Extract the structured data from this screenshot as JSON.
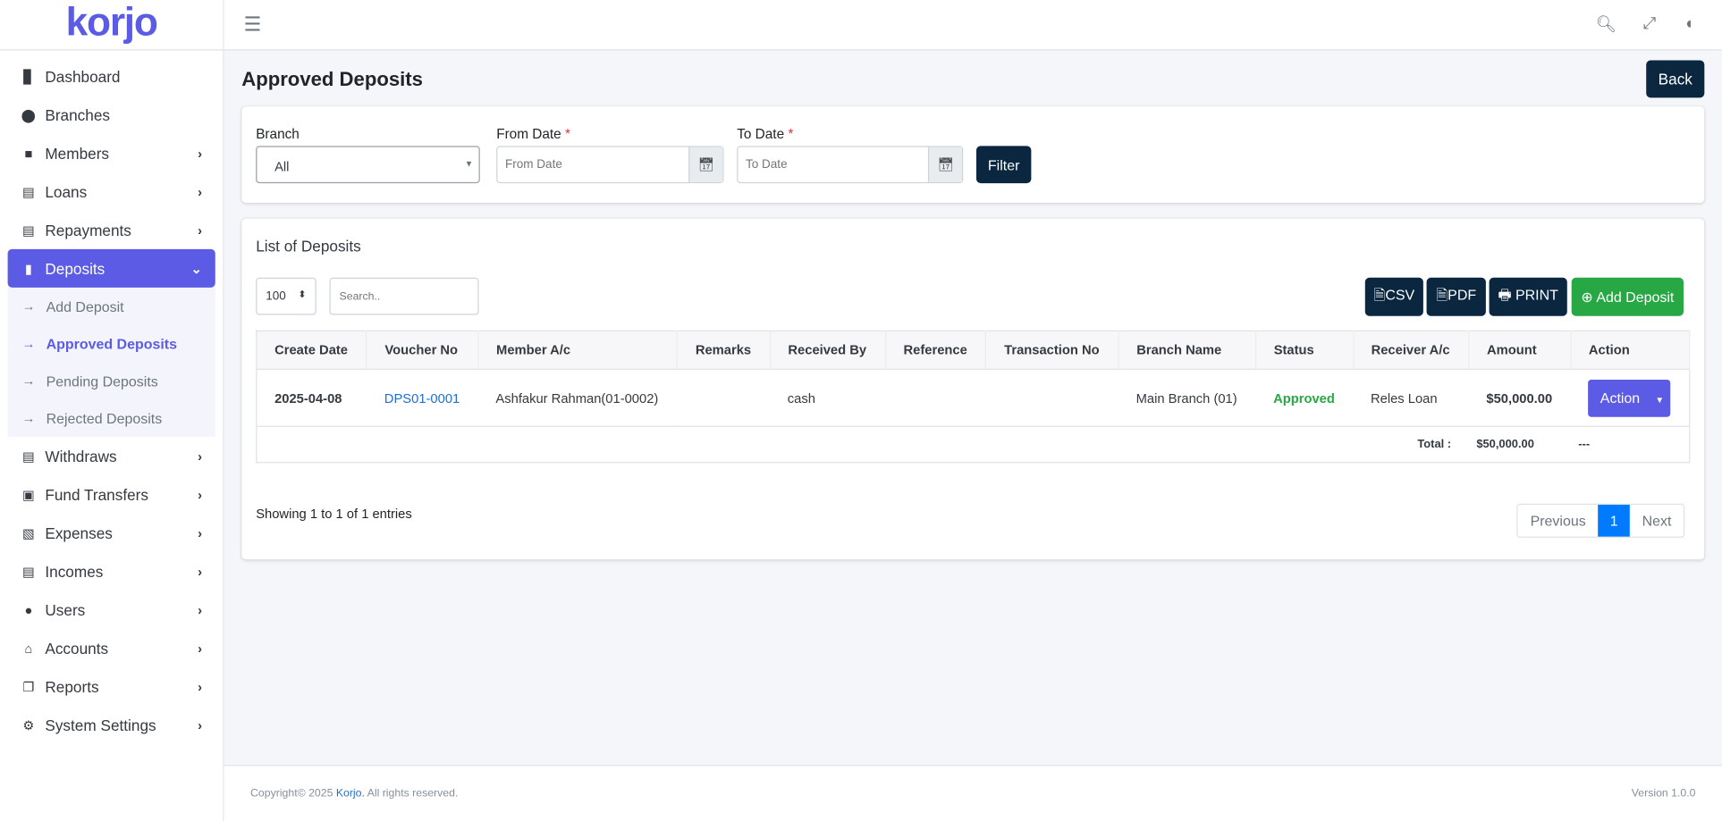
{
  "brand": {
    "logo": "korjo",
    "accent": "#5b5be6"
  },
  "sidebar": {
    "items": [
      {
        "label": "Dashboard",
        "icon": "chart-bar-icon",
        "chev": false
      },
      {
        "label": "Branches",
        "icon": "map-marker-icon",
        "chev": false
      },
      {
        "label": "Members",
        "icon": "address-book-icon",
        "chev": true
      },
      {
        "label": "Loans",
        "icon": "file-invoice-dollar-icon",
        "chev": true
      },
      {
        "label": "Repayments",
        "icon": "file-alt-icon",
        "chev": true
      },
      {
        "label": "Deposits",
        "icon": "receipt-icon",
        "chev": true,
        "active": true,
        "sub": [
          {
            "label": "Add Deposit"
          },
          {
            "label": "Approved Deposits",
            "active": true
          },
          {
            "label": "Pending Deposits"
          },
          {
            "label": "Rejected Deposits"
          }
        ]
      },
      {
        "label": "Withdraws",
        "icon": "file-invoice-dollar-icon",
        "chev": true
      },
      {
        "label": "Fund Transfers",
        "icon": "suitcase-icon",
        "chev": true
      },
      {
        "label": "Expenses",
        "icon": "file-excel-icon",
        "chev": true
      },
      {
        "label": "Incomes",
        "icon": "file-invoice-dollar-icon",
        "chev": true
      },
      {
        "label": "Users",
        "icon": "user-icon",
        "chev": true
      },
      {
        "label": "Accounts",
        "icon": "bank-icon",
        "chev": true
      },
      {
        "label": "Reports",
        "icon": "copy-icon",
        "chev": true
      },
      {
        "label": "System Settings",
        "icon": "gear-icon",
        "chev": true
      }
    ]
  },
  "page": {
    "title": "Approved Deposits",
    "back": "Back"
  },
  "filter": {
    "branch_label": "Branch",
    "branch_value": "All",
    "from_label": "From Date",
    "from_placeholder": "From Date",
    "to_label": "To Date",
    "to_placeholder": "To Date",
    "required_mark": "*",
    "button": "Filter"
  },
  "list": {
    "title": "List of Deposits",
    "page_length": "100",
    "search_placeholder": "Search..",
    "csv": "CSV",
    "pdf": "PDF",
    "print": "PRINT",
    "add": "Add Deposit",
    "columns": [
      "Create Date",
      "Voucher No",
      "Member A/c",
      "Remarks",
      "Received By",
      "Reference",
      "Transaction No",
      "Branch Name",
      "Status",
      "Receiver A/c",
      "Amount",
      "Action"
    ],
    "rows": [
      {
        "date": "2025-04-08",
        "voucher": "DPS01-0001",
        "member": "Ashfakur Rahman(01-0002)",
        "remarks": "",
        "received_by": "cash",
        "reference": "",
        "transaction": "",
        "branch": "Main Branch (01)",
        "status": "Approved",
        "receiver": "Reles Loan",
        "amount": "$50,000.00",
        "action": "Action"
      }
    ],
    "total_label": "Total :",
    "total_amount": "$50,000.00",
    "total_action": "---",
    "info": "Showing 1 to 1 of 1 entries",
    "prev": "Previous",
    "page": "1",
    "next": "Next"
  },
  "footer": {
    "copy_pre": "Copyright© 2025 ",
    "copy_link": "Korjo.",
    "copy_post": " All rights reserved.",
    "version": "Version 1.0.0"
  }
}
